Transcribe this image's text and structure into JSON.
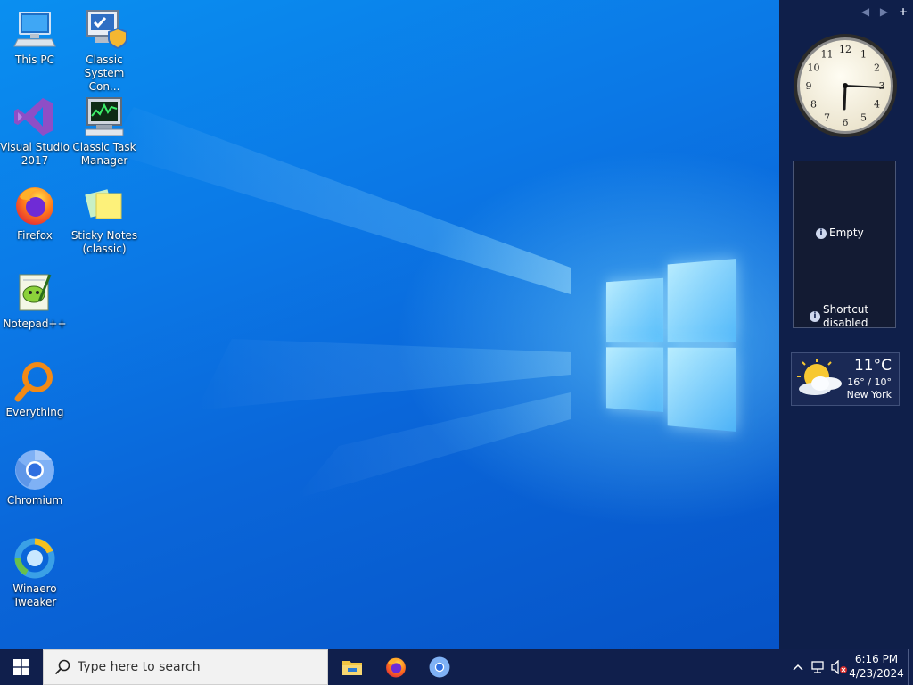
{
  "desktop": {
    "icons": [
      {
        "label": "This PC",
        "icon": "this-pc-icon"
      },
      {
        "label": "Classic System Con...",
        "icon": "control-panel-icon"
      },
      {
        "label": "Visual Studio 2017",
        "icon": "visual-studio-icon"
      },
      {
        "label": "Classic Task Manager",
        "icon": "task-manager-icon"
      },
      {
        "label": "Firefox",
        "icon": "firefox-icon"
      },
      {
        "label": "Sticky Notes (classic)",
        "icon": "sticky-notes-icon"
      },
      {
        "label": "Notepad++",
        "icon": "notepadpp-icon"
      },
      {
        "label": "Everything",
        "icon": "everything-icon"
      },
      {
        "label": "Chromium",
        "icon": "chromium-icon"
      },
      {
        "label": "Winaero Tweaker",
        "icon": "winaero-tweaker-icon"
      }
    ]
  },
  "sidebar": {
    "nav_prev": "◀",
    "nav_next": "▶",
    "nav_add": "+",
    "clock": {
      "numerals": [
        "12",
        "1",
        "2",
        "3",
        "4",
        "5",
        "6",
        "7",
        "8",
        "9",
        "10",
        "11"
      ],
      "time": "6:16"
    },
    "slideshow": {
      "empty_text": "Empty",
      "shortcut_text_1": "Shortcut",
      "shortcut_text_2": "disabled"
    },
    "weather": {
      "temperature": "11°C",
      "range": "16° / 10°",
      "city": "New York"
    }
  },
  "taskbar": {
    "search_placeholder": "Type here to search",
    "pinned": [
      "file-explorer-icon",
      "firefox-icon",
      "chromium-icon"
    ],
    "time": "6:16 PM",
    "date": "4/23/2024"
  },
  "colors": {
    "taskbar": "#101f4c",
    "sidebar": "#0f1f4a",
    "wallpaper": "#0a78e6"
  }
}
